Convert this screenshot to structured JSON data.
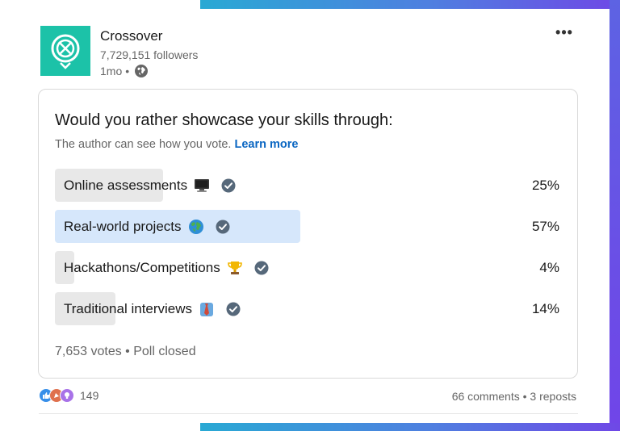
{
  "post": {
    "author": "Crossover",
    "followers": "7,729,151 followers",
    "age": "1mo",
    "dot": "•",
    "more": "•••"
  },
  "poll": {
    "question": "Would you rather showcase your skills through:",
    "note": "The author can see how you vote.",
    "learn_more": "Learn more",
    "options": [
      {
        "label": "Online assessments",
        "emoji": "desktop-computer-icon",
        "percent": "25%",
        "share": 0.25,
        "selected": false
      },
      {
        "label": "Real-world projects",
        "emoji": "globe-icon",
        "percent": "57%",
        "share": 0.57,
        "selected": true
      },
      {
        "label": "Hackathons/Competitions",
        "emoji": "trophy-icon",
        "percent": "4%",
        "share": 0.04,
        "selected": false
      },
      {
        "label": "Traditional interviews",
        "emoji": "necktie-icon",
        "percent": "14%",
        "share": 0.14,
        "selected": false
      }
    ],
    "footer": "7,653 votes • Poll closed"
  },
  "social": {
    "reaction_count": "149",
    "comments_reposts": "66 comments • 3 reposts"
  },
  "colors": {
    "brand_teal": "#1cc2a8",
    "link_blue": "#0a66c2",
    "selected_fill": "#d6e7fb",
    "bar_fill": "#e8e8e8"
  }
}
